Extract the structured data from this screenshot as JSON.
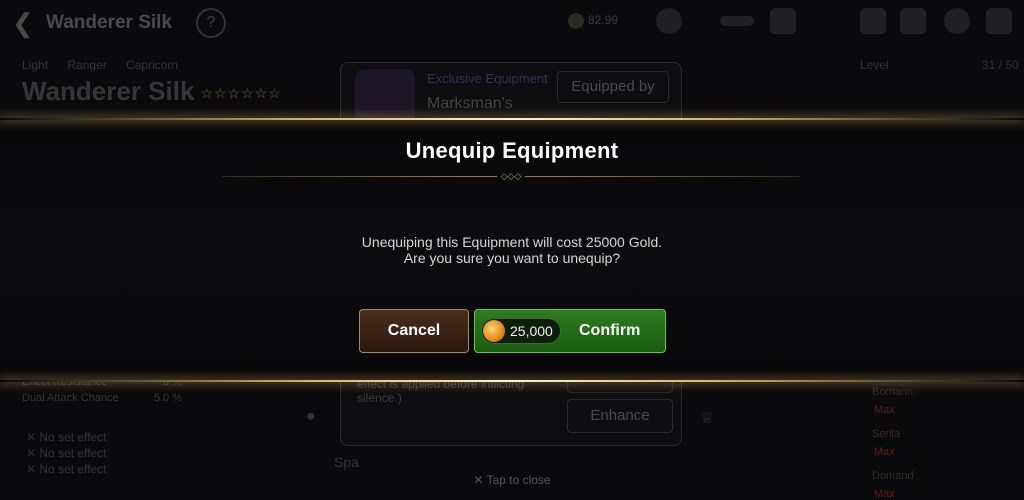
{
  "top": {
    "title": "Wanderer Silk",
    "help": "?",
    "gold_res": "82.99"
  },
  "hero": {
    "tags": [
      "Light",
      "Ranger",
      "Capricorn"
    ],
    "name": "Wanderer Silk",
    "stars": "☆☆☆☆☆☆",
    "stats": [
      {
        "label": "Effect Resistance",
        "value": "0 %"
      },
      {
        "label": "Dual Attack Chance",
        "value": "5.0 %"
      }
    ],
    "set_effects": [
      "No set effect",
      "No set effect",
      "No set effect"
    ]
  },
  "roster": {
    "level": "Level",
    "level_val": "31 / 50",
    "names": [
      "Bomann",
      "Serila",
      "Domand"
    ],
    "max": "Max"
  },
  "card": {
    "exclusive_label": "Exclusive Equipment",
    "item_name": "Marksman's",
    "equipped_by": "Equipped by",
    "description": "effect is applied before inflicting silence.)",
    "enhance": "Enhance",
    "spare": "Spa"
  },
  "dialog": {
    "title": "Unequip Equipment",
    "message_line1": "Unequiping this Equipment will cost 25000 Gold.",
    "message_line2": "Are you sure you want to unequip?",
    "cancel_label": "Cancel",
    "confirm_label": "Confirm",
    "cost": "25,000"
  },
  "tap_to_close": "✕ Tap to close",
  "colors": {
    "confirm_green": "#2f7d1f",
    "cancel_brown": "#4a2f1c",
    "gold_line": "#d7b26a"
  }
}
